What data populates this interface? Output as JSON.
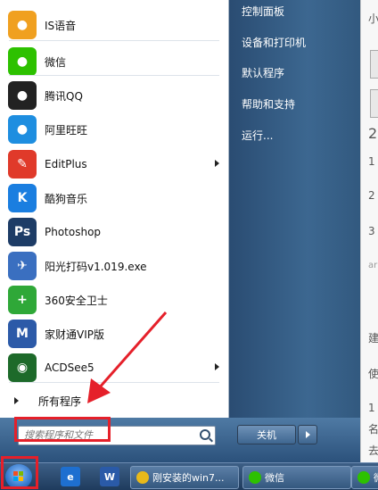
{
  "programs": [
    {
      "label": "IS语音",
      "icon": "is-voice-icon",
      "color": "#f0a020",
      "glyph": "●",
      "has_submenu": false
    },
    {
      "label": "微信",
      "icon": "wechat-icon",
      "color": "#2dc100",
      "glyph": "●",
      "has_submenu": false
    },
    {
      "label": "腾讯QQ",
      "icon": "qq-penguin-icon",
      "color": "#222222",
      "glyph": "●",
      "has_submenu": false
    },
    {
      "label": "阿里旺旺",
      "icon": "aliwangwang-icon",
      "color": "#1e8ee0",
      "glyph": "●",
      "has_submenu": false
    },
    {
      "label": "EditPlus",
      "icon": "editplus-icon",
      "color": "#e03a2a",
      "glyph": "✎",
      "has_submenu": true
    },
    {
      "label": "酷狗音乐",
      "icon": "kugou-icon",
      "color": "#1a7ee0",
      "glyph": "K",
      "has_submenu": false
    },
    {
      "label": "Photoshop",
      "icon": "photoshop-icon",
      "color": "#1d3c66",
      "glyph": "Ps",
      "has_submenu": false
    },
    {
      "label": "阳光打码v1.019.exe",
      "icon": "exe-plane-icon",
      "color": "#3a6fc0",
      "glyph": "✈",
      "has_submenu": false
    },
    {
      "label": "360安全卫士",
      "icon": "360-safe-icon",
      "color": "#2fa838",
      "glyph": "+",
      "has_submenu": false
    },
    {
      "label": "家财通VIP版",
      "icon": "jiacaitong-icon",
      "color": "#2c5aa8",
      "glyph": "M",
      "has_submenu": false
    },
    {
      "label": "ACDSee5",
      "icon": "acdsee-icon",
      "color": "#1d6a2a",
      "glyph": "◉",
      "has_submenu": true
    }
  ],
  "all_programs": "所有程序",
  "search": {
    "placeholder": "搜索程序和文件"
  },
  "right_menu": [
    "控制面板",
    "设备和打印机",
    "默认程序",
    "帮助和支持",
    "运行..."
  ],
  "shutdown_label": "关机",
  "taskbar": {
    "tasks": [
      {
        "label": "刚安装的win7...",
        "icon": "chrome-icon",
        "color": "#e8b91a"
      },
      {
        "label": "微信",
        "icon": "wechat-icon",
        "color": "#2dc100"
      },
      {
        "label": "微信",
        "icon": "wechat-icon",
        "color": "#2dc100"
      }
    ],
    "quick": [
      {
        "icon": "ie-icon",
        "glyph": "e",
        "color": "#1e6fd0"
      },
      {
        "icon": "word-icon",
        "glyph": "W",
        "color": "#2a5aa8"
      }
    ]
  },
  "background_doc": {
    "chars": [
      "小",
      "2",
      "1",
      "2",
      "3",
      "ar",
      "建",
      "使",
      "1",
      "名",
      "去"
    ]
  },
  "colors": {
    "annotation": "#e5202a",
    "menu_blue": "#2a4c72"
  }
}
